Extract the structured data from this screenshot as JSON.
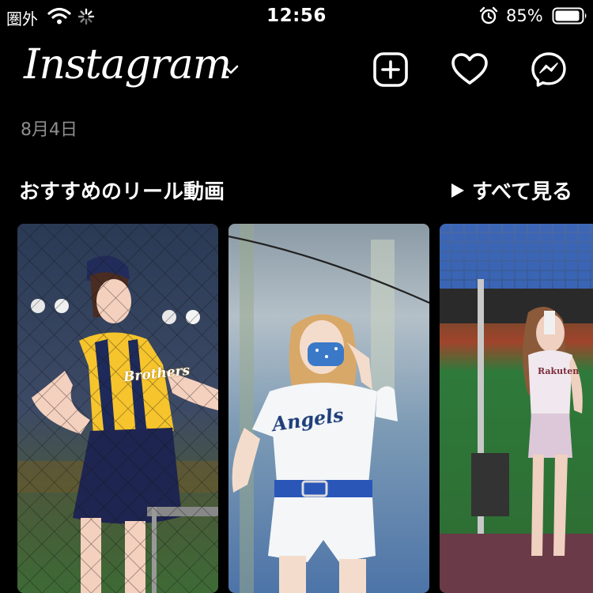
{
  "status_bar": {
    "carrier": "圏外",
    "time": "12:56",
    "battery": "85%"
  },
  "header": {
    "brand": "Instagram",
    "icons": [
      "chevron-down-icon",
      "plus-square-icon",
      "heart-icon",
      "messenger-icon"
    ]
  },
  "date_label": "8月4日",
  "reels_section": {
    "title": "おすすめのリール動画",
    "see_all": "すべて見る",
    "cards": [
      {
        "jersey_text": "Brothers"
      },
      {
        "jersey_text": "Angels"
      },
      {
        "jersey_text": "Rakuten"
      }
    ]
  },
  "colors": {
    "background": "#000000",
    "text": "#ffffff",
    "muted": "#8e8e8e"
  }
}
